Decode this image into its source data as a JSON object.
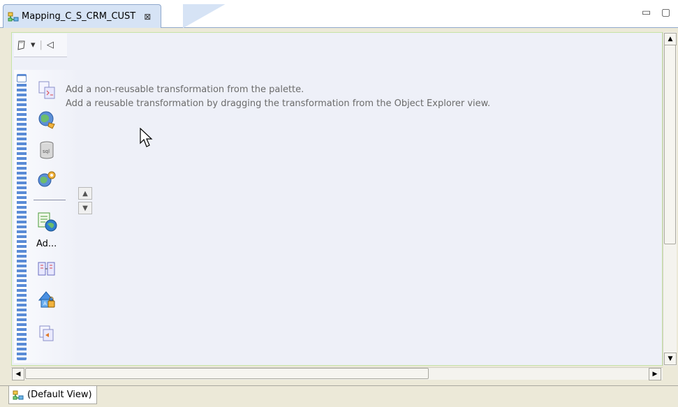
{
  "tab": {
    "title": "Mapping_C_S_CRM_CUST",
    "close_glyph": "⊠",
    "icon": "mapping-icon"
  },
  "window_controls": {
    "minimize": "▭",
    "maximize": "▢"
  },
  "palette": {
    "toolbar": {
      "icon": "pin-icon",
      "dropdown": "▾",
      "collapse": "◁"
    },
    "items": [
      {
        "icon": "expression-icon"
      },
      {
        "icon": "lookup-icon"
      },
      {
        "icon": "sql-icon"
      },
      {
        "icon": "web-service-icon"
      },
      {
        "icon": "address-validator-icon",
        "label": "Ad..."
      },
      {
        "icon": "association-icon"
      },
      {
        "icon": "key-generator-icon"
      },
      {
        "icon": "misc-transform-icon"
      }
    ],
    "scroll_up": "▲",
    "scroll_down": "▼"
  },
  "hints": {
    "line1": "Add a non-reusable transformation from the palette.",
    "line2": "Add a reusable transformation by dragging the transformation from the Object Explorer view."
  },
  "scrollbars": {
    "up": "▲",
    "down": "▼",
    "left": "◀",
    "right": "▶"
  },
  "bottom_tab": {
    "label": "(Default View)",
    "icon": "mapping-icon"
  },
  "colors": {
    "editor_bg": "#eef0f8",
    "editor_border": "#c6e3a6",
    "tab_bg": "#d6e3f5",
    "chrome": "#ece9d8"
  }
}
